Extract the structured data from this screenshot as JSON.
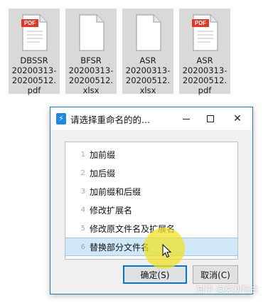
{
  "files": [
    {
      "badge": "PDF",
      "name_lines": [
        "DBSSR",
        "20200313-",
        "20200512.",
        "pdf"
      ]
    },
    {
      "badge": "",
      "name_lines": [
        "BFSR",
        "20200313-",
        "20200512.",
        "xlsx"
      ]
    },
    {
      "badge": "",
      "name_lines": [
        "ASR",
        "20200313-",
        "20200512.",
        "xlsx"
      ]
    },
    {
      "badge": "PDF",
      "name_lines": [
        "ASR",
        "20200313-",
        "20200512.",
        "pdf"
      ]
    }
  ],
  "dialog": {
    "title": "请选择重命名的的...",
    "app_icon_glyph": "⚡",
    "minimize_icon": "minimize-icon",
    "maximize_icon": "maximize-icon",
    "close_glyph": "✕",
    "options": [
      {
        "num": "1",
        "label": "加前缀"
      },
      {
        "num": "2",
        "label": "加后缀"
      },
      {
        "num": "3",
        "label": "加前缀和后缀"
      },
      {
        "num": "4",
        "label": "修改扩展名"
      },
      {
        "num": "5",
        "label": "修改原文件名及扩展名"
      },
      {
        "num": "6",
        "label": "替换部分文件名"
      }
    ],
    "selected_index": 5,
    "ok_label": "确定(S)",
    "cancel_label": "取消(C)"
  },
  "watermark": "知乎 @克利马古",
  "colors": {
    "pdf_badge": "#d93a2b",
    "selection": "#cfe7f7",
    "cursor_highlight": "#f0e128",
    "dialog_border": "#1e7fb8"
  }
}
